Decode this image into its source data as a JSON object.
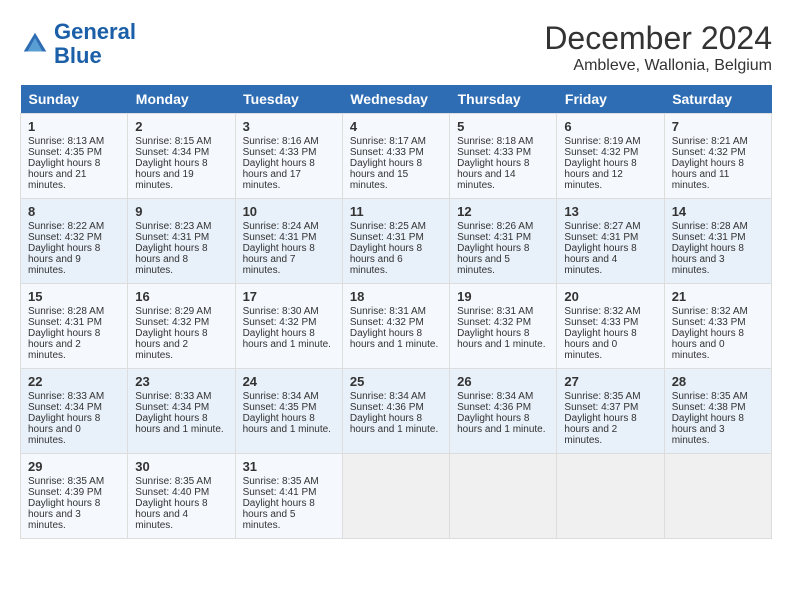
{
  "header": {
    "logo_line1": "General",
    "logo_line2": "Blue",
    "month_year": "December 2024",
    "location": "Ambleve, Wallonia, Belgium"
  },
  "days_of_week": [
    "Sunday",
    "Monday",
    "Tuesday",
    "Wednesday",
    "Thursday",
    "Friday",
    "Saturday"
  ],
  "weeks": [
    [
      {
        "day": "1",
        "sunrise": "8:13 AM",
        "sunset": "4:35 PM",
        "daylight": "8 hours and 21 minutes."
      },
      {
        "day": "2",
        "sunrise": "8:15 AM",
        "sunset": "4:34 PM",
        "daylight": "8 hours and 19 minutes."
      },
      {
        "day": "3",
        "sunrise": "8:16 AM",
        "sunset": "4:33 PM",
        "daylight": "8 hours and 17 minutes."
      },
      {
        "day": "4",
        "sunrise": "8:17 AM",
        "sunset": "4:33 PM",
        "daylight": "8 hours and 15 minutes."
      },
      {
        "day": "5",
        "sunrise": "8:18 AM",
        "sunset": "4:33 PM",
        "daylight": "8 hours and 14 minutes."
      },
      {
        "day": "6",
        "sunrise": "8:19 AM",
        "sunset": "4:32 PM",
        "daylight": "8 hours and 12 minutes."
      },
      {
        "day": "7",
        "sunrise": "8:21 AM",
        "sunset": "4:32 PM",
        "daylight": "8 hours and 11 minutes."
      }
    ],
    [
      {
        "day": "8",
        "sunrise": "8:22 AM",
        "sunset": "4:32 PM",
        "daylight": "8 hours and 9 minutes."
      },
      {
        "day": "9",
        "sunrise": "8:23 AM",
        "sunset": "4:31 PM",
        "daylight": "8 hours and 8 minutes."
      },
      {
        "day": "10",
        "sunrise": "8:24 AM",
        "sunset": "4:31 PM",
        "daylight": "8 hours and 7 minutes."
      },
      {
        "day": "11",
        "sunrise": "8:25 AM",
        "sunset": "4:31 PM",
        "daylight": "8 hours and 6 minutes."
      },
      {
        "day": "12",
        "sunrise": "8:26 AM",
        "sunset": "4:31 PM",
        "daylight": "8 hours and 5 minutes."
      },
      {
        "day": "13",
        "sunrise": "8:27 AM",
        "sunset": "4:31 PM",
        "daylight": "8 hours and 4 minutes."
      },
      {
        "day": "14",
        "sunrise": "8:28 AM",
        "sunset": "4:31 PM",
        "daylight": "8 hours and 3 minutes."
      }
    ],
    [
      {
        "day": "15",
        "sunrise": "8:28 AM",
        "sunset": "4:31 PM",
        "daylight": "8 hours and 2 minutes."
      },
      {
        "day": "16",
        "sunrise": "8:29 AM",
        "sunset": "4:32 PM",
        "daylight": "8 hours and 2 minutes."
      },
      {
        "day": "17",
        "sunrise": "8:30 AM",
        "sunset": "4:32 PM",
        "daylight": "8 hours and 1 minute."
      },
      {
        "day": "18",
        "sunrise": "8:31 AM",
        "sunset": "4:32 PM",
        "daylight": "8 hours and 1 minute."
      },
      {
        "day": "19",
        "sunrise": "8:31 AM",
        "sunset": "4:32 PM",
        "daylight": "8 hours and 1 minute."
      },
      {
        "day": "20",
        "sunrise": "8:32 AM",
        "sunset": "4:33 PM",
        "daylight": "8 hours and 0 minutes."
      },
      {
        "day": "21",
        "sunrise": "8:32 AM",
        "sunset": "4:33 PM",
        "daylight": "8 hours and 0 minutes."
      }
    ],
    [
      {
        "day": "22",
        "sunrise": "8:33 AM",
        "sunset": "4:34 PM",
        "daylight": "8 hours and 0 minutes."
      },
      {
        "day": "23",
        "sunrise": "8:33 AM",
        "sunset": "4:34 PM",
        "daylight": "8 hours and 1 minute."
      },
      {
        "day": "24",
        "sunrise": "8:34 AM",
        "sunset": "4:35 PM",
        "daylight": "8 hours and 1 minute."
      },
      {
        "day": "25",
        "sunrise": "8:34 AM",
        "sunset": "4:36 PM",
        "daylight": "8 hours and 1 minute."
      },
      {
        "day": "26",
        "sunrise": "8:34 AM",
        "sunset": "4:36 PM",
        "daylight": "8 hours and 1 minute."
      },
      {
        "day": "27",
        "sunrise": "8:35 AM",
        "sunset": "4:37 PM",
        "daylight": "8 hours and 2 minutes."
      },
      {
        "day": "28",
        "sunrise": "8:35 AM",
        "sunset": "4:38 PM",
        "daylight": "8 hours and 3 minutes."
      }
    ],
    [
      {
        "day": "29",
        "sunrise": "8:35 AM",
        "sunset": "4:39 PM",
        "daylight": "8 hours and 3 minutes."
      },
      {
        "day": "30",
        "sunrise": "8:35 AM",
        "sunset": "4:40 PM",
        "daylight": "8 hours and 4 minutes."
      },
      {
        "day": "31",
        "sunrise": "8:35 AM",
        "sunset": "4:41 PM",
        "daylight": "8 hours and 5 minutes."
      },
      null,
      null,
      null,
      null
    ]
  ],
  "labels": {
    "sunrise": "Sunrise:",
    "sunset": "Sunset:",
    "daylight": "Daylight hours"
  }
}
